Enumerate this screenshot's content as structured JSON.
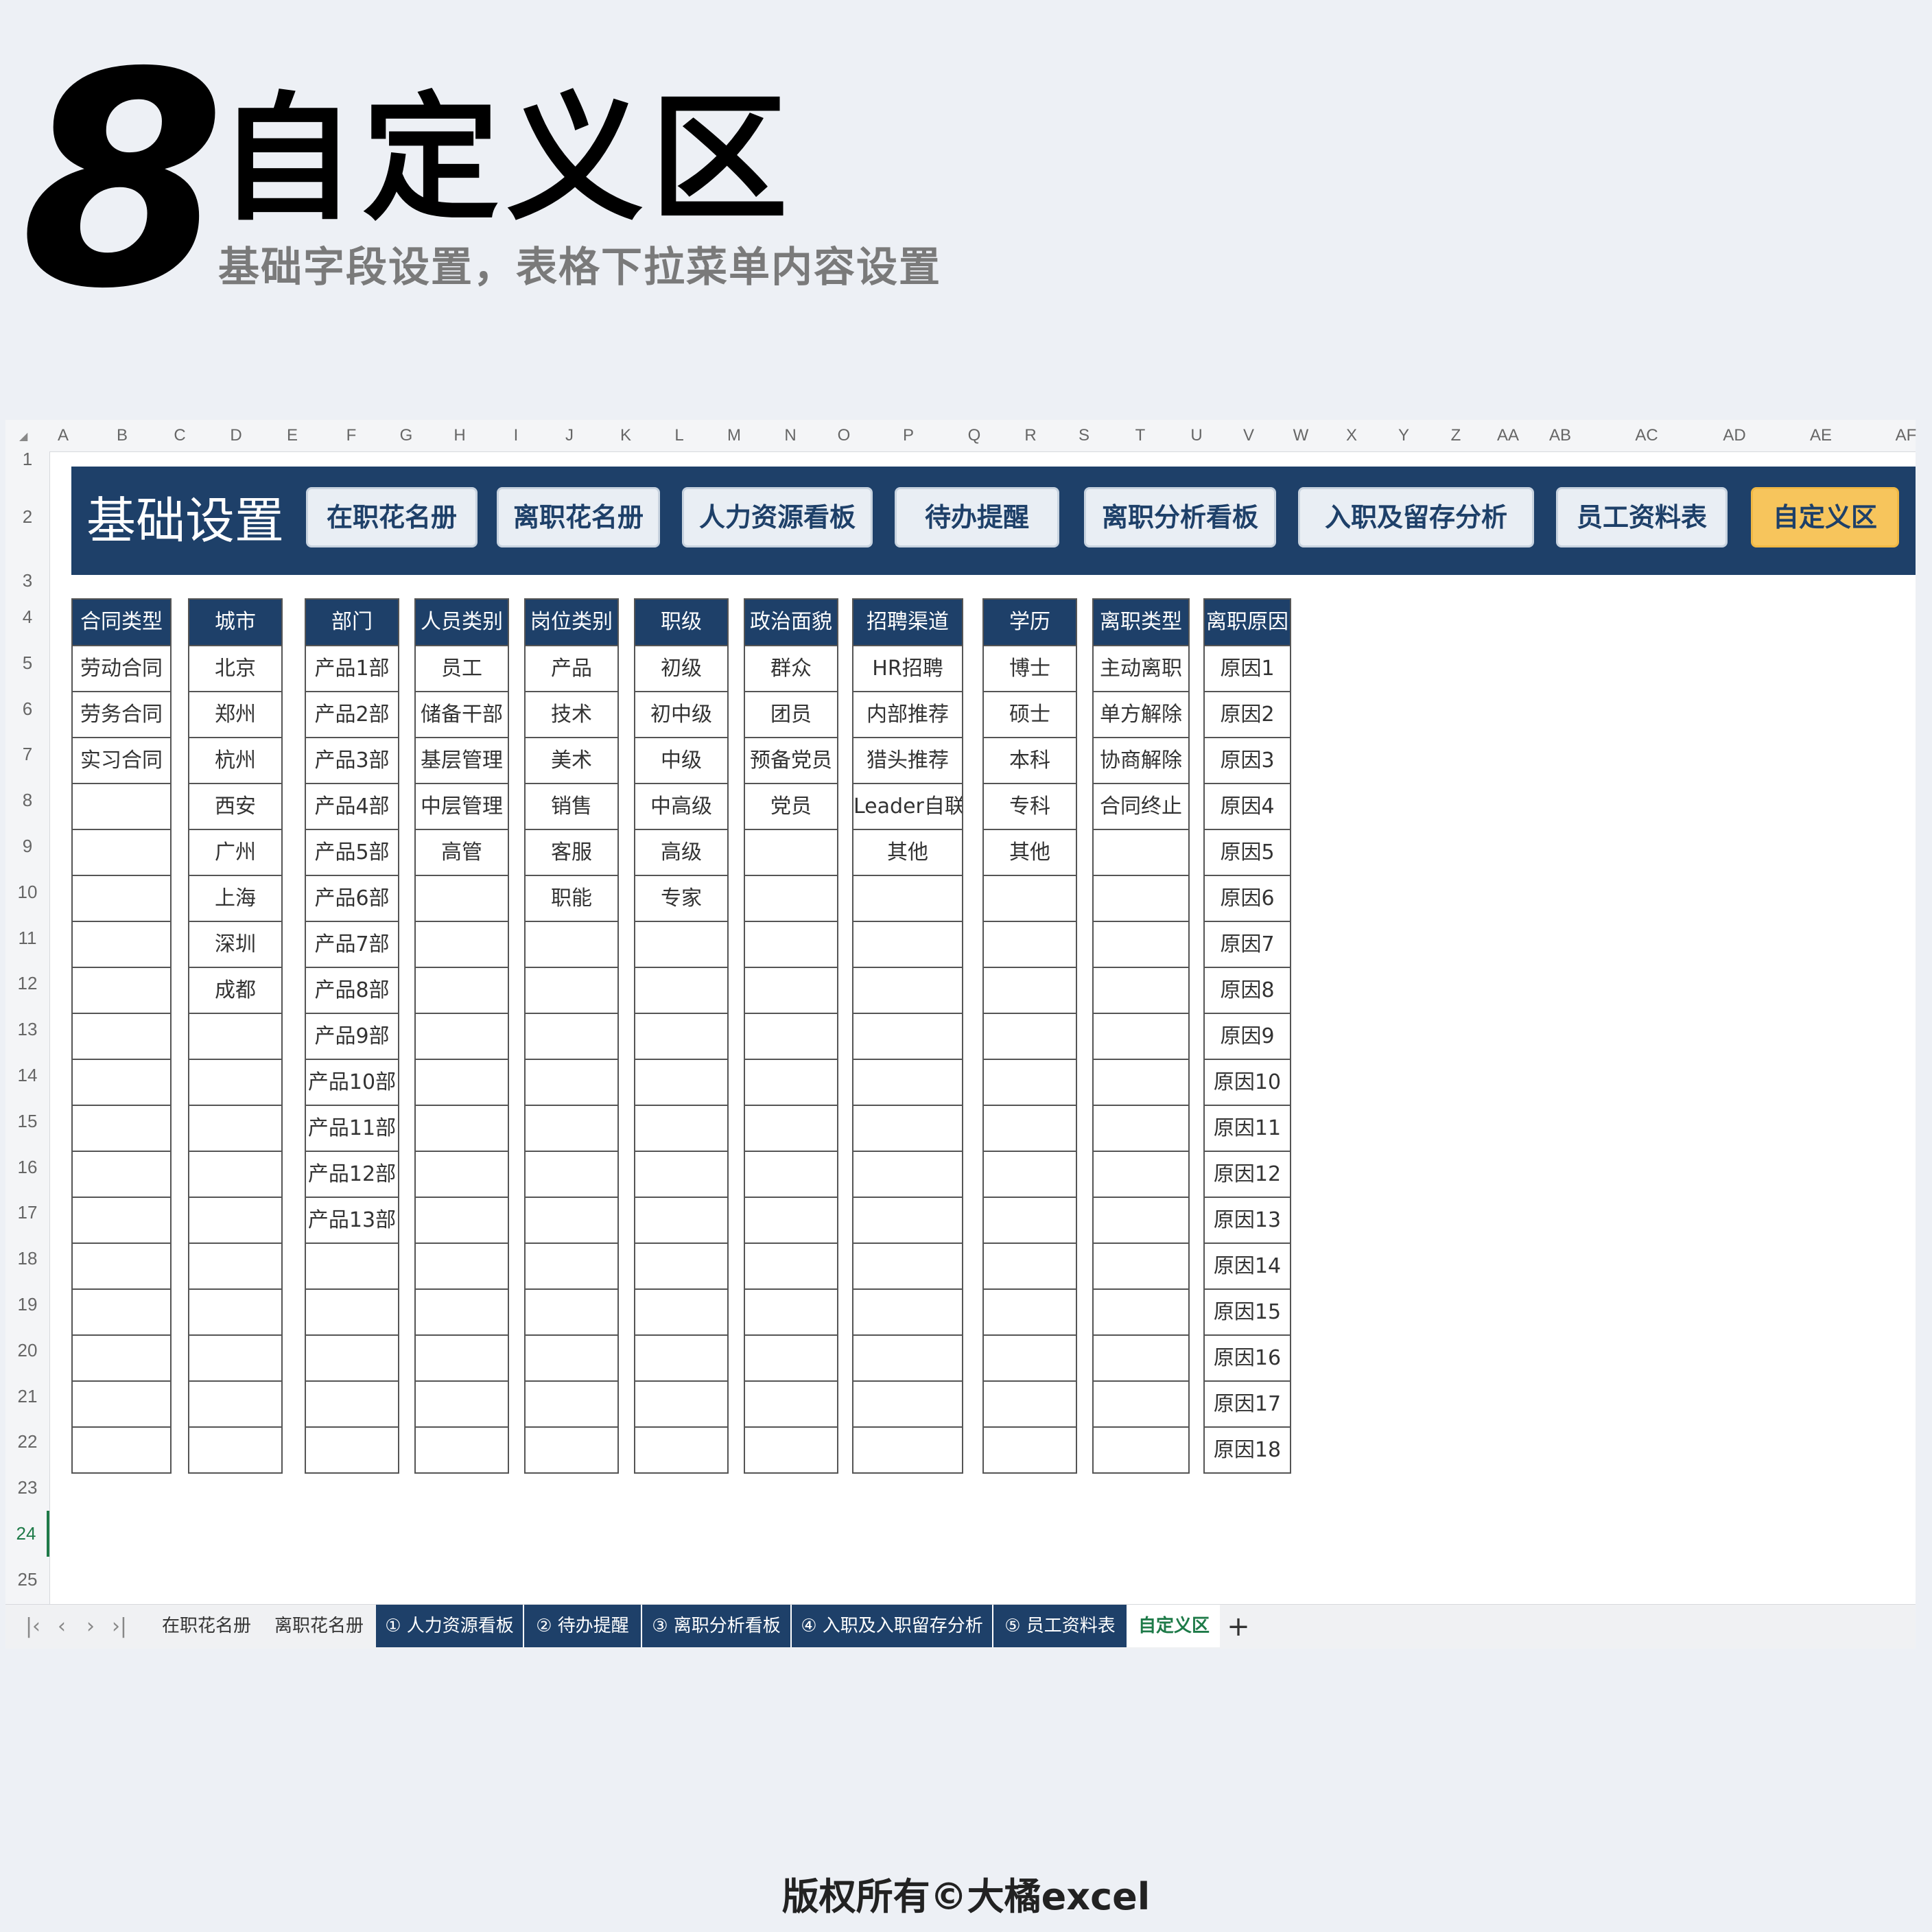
{
  "hero": {
    "number": "8",
    "title": "自定义区",
    "subtitle": "基础字段设置，表格下拉菜单内容设置"
  },
  "footer": "版权所有©大橘excel",
  "spreadsheet": {
    "corner_icon": "select-all-icon",
    "column_letters": [
      "A",
      "B",
      "C",
      "D",
      "E",
      "F",
      "G",
      "H",
      "I",
      "J",
      "K",
      "L",
      "M",
      "N",
      "O",
      "P",
      "Q",
      "R",
      "S",
      "T",
      "U",
      "V",
      "W",
      "X",
      "Y",
      "Z",
      "AA",
      "AB",
      "AC",
      "AD",
      "AE",
      "AF"
    ],
    "row_numbers": [
      "1",
      "2",
      "3",
      "4",
      "5",
      "6",
      "7",
      "8",
      "9",
      "10",
      "11",
      "12",
      "13",
      "14",
      "15",
      "16",
      "17",
      "18",
      "19",
      "20",
      "21",
      "22",
      "23",
      "24",
      "25"
    ],
    "active_row": "24",
    "banner": {
      "title": "基础设置",
      "buttons": [
        "在职花名册",
        "离职花名册",
        "人力资源看板",
        "待办提醒",
        "离职分析看板",
        "入职及留存分析",
        "员工资料表",
        "自定义区"
      ],
      "active_button": "自定义区"
    },
    "tables": [
      {
        "header": "合同类型",
        "values": [
          "劳动合同",
          "劳务合同",
          "实习合同",
          "",
          "",
          "",
          "",
          "",
          "",
          "",
          "",
          "",
          "",
          "",
          "",
          "",
          "",
          ""
        ]
      },
      {
        "header": "城市",
        "values": [
          "北京",
          "郑州",
          "杭州",
          "西安",
          "广州",
          "上海",
          "深圳",
          "成都",
          "",
          "",
          "",
          "",
          "",
          "",
          "",
          "",
          "",
          ""
        ]
      },
      {
        "header": "部门",
        "values": [
          "产品1部",
          "产品2部",
          "产品3部",
          "产品4部",
          "产品5部",
          "产品6部",
          "产品7部",
          "产品8部",
          "产品9部",
          "产品10部",
          "产品11部",
          "产品12部",
          "产品13部",
          "",
          "",
          "",
          "",
          ""
        ]
      },
      {
        "header": "人员类别",
        "values": [
          "员工",
          "储备干部",
          "基层管理",
          "中层管理",
          "高管",
          "",
          "",
          "",
          "",
          "",
          "",
          "",
          "",
          "",
          "",
          "",
          "",
          ""
        ]
      },
      {
        "header": "岗位类别",
        "values": [
          "产品",
          "技术",
          "美术",
          "销售",
          "客服",
          "职能",
          "",
          "",
          "",
          "",
          "",
          "",
          "",
          "",
          "",
          "",
          "",
          ""
        ]
      },
      {
        "header": "职级",
        "values": [
          "初级",
          "初中级",
          "中级",
          "中高级",
          "高级",
          "专家",
          "",
          "",
          "",
          "",
          "",
          "",
          "",
          "",
          "",
          "",
          "",
          ""
        ]
      },
      {
        "header": "政治面貌",
        "values": [
          "群众",
          "团员",
          "预备党员",
          "党员",
          "",
          "",
          "",
          "",
          "",
          "",
          "",
          "",
          "",
          "",
          "",
          "",
          "",
          ""
        ]
      },
      {
        "header": "招聘渠道",
        "values": [
          "HR招聘",
          "内部推荐",
          "猎头推荐",
          "Leader自联",
          "其他",
          "",
          "",
          "",
          "",
          "",
          "",
          "",
          "",
          "",
          "",
          "",
          "",
          ""
        ]
      },
      {
        "header": "学历",
        "values": [
          "博士",
          "硕士",
          "本科",
          "专科",
          "其他",
          "",
          "",
          "",
          "",
          "",
          "",
          "",
          "",
          "",
          "",
          "",
          "",
          ""
        ]
      },
      {
        "header": "离职类型",
        "values": [
          "主动离职",
          "单方解除",
          "协商解除",
          "合同终止",
          "",
          "",
          "",
          "",
          "",
          "",
          "",
          "",
          "",
          "",
          "",
          "",
          "",
          ""
        ]
      },
      {
        "header": "离职原因",
        "values": [
          "原因1",
          "原因2",
          "原因3",
          "原因4",
          "原因5",
          "原因6",
          "原因7",
          "原因8",
          "原因9",
          "原因10",
          "原因11",
          "原因12",
          "原因13",
          "原因14",
          "原因15",
          "原因16",
          "原因17",
          "原因18"
        ]
      }
    ],
    "sheet_tabs": {
      "nav_icons": [
        "first-sheet-icon",
        "prev-sheet-icon",
        "next-sheet-icon",
        "last-sheet-icon"
      ],
      "tabs": [
        "在职花名册",
        "离职花名册",
        "① 人力资源看板",
        "② 待办提醒",
        "③ 离职分析看板",
        "④ 入职及入职留存分析",
        "⑤ 员工资料表",
        "自定义区"
      ],
      "active_tab": "自定义区",
      "add_icon": "plus-icon"
    },
    "colors": {
      "banner_bg": "#1e4069",
      "active_button": "#f7c55c",
      "active_tab_text": "#1e7a48"
    }
  }
}
